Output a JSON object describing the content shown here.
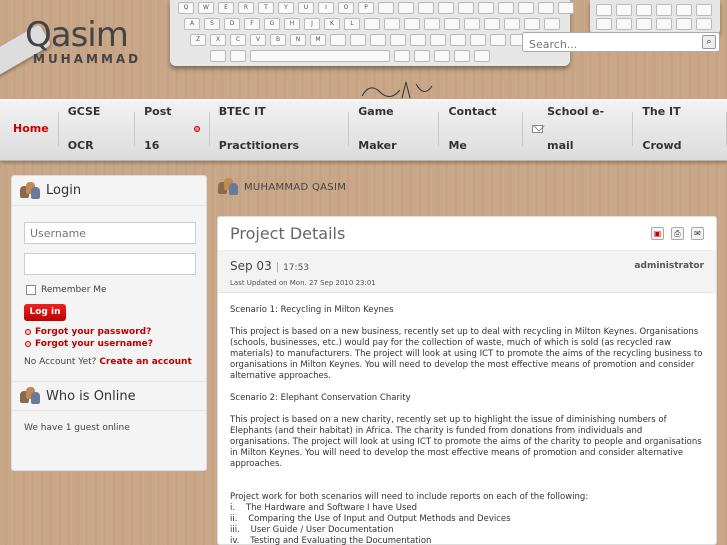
{
  "header": {
    "logo_main": "Qasim",
    "logo_sub": "MUHAMMAD",
    "search_placeholder": "Search..."
  },
  "nav": {
    "items": [
      {
        "label": "Home",
        "active": true
      },
      {
        "label": "GCSE OCR"
      },
      {
        "label": "Post 16"
      },
      {
        "label": "BTEC IT Practitioners"
      },
      {
        "label": "Game Maker"
      },
      {
        "label": "Contact Me"
      },
      {
        "label": "School e-mail"
      },
      {
        "label": "The IT Crowd"
      }
    ]
  },
  "login": {
    "title": "Login",
    "username_placeholder": "Username",
    "password_placeholder": "",
    "remember_label": "Remember Me",
    "login_button": "Log in",
    "forgot_password": "Forgot your password?",
    "forgot_username": "Forgot your username?",
    "no_account": "No Account Yet?",
    "create_account": "Create an account"
  },
  "who_online": {
    "title": "Who is Online",
    "text": "We have 1 guest online"
  },
  "breadcrumb": "MUHAMMAD QASIM",
  "article": {
    "title": "Project Details",
    "date": "Sep 03",
    "time": "17:53",
    "author": "administrator",
    "updated": "Last Updated on Mon. 27 Sep 2010 23:01",
    "scenario1_title": "Scenario 1: Recycling in Milton Keynes",
    "scenario1_text": "This project is based on a new business, recently set up to deal with recycling in Milton Keynes. Organisations (schools, businesses, etc.) would pay for the collection of waste, much of which is sold (as recycled raw materials) to manufacturers. The project will look at using ICT to promote the aims of the recycling business to organisations in Milton Keynes. You will need to develop the most effective means of promotion and consider alternative approaches.",
    "scenario2_title": "Scenario 2: Elephant Conservation Charity",
    "scenario2_text": "This project is based on a new charity, recently set up to highlight the issue of diminishing numbers of Elephants (and their habitat) in Africa. The charity is funded from donations from individuals and organisations. The project will look at using ICT to promote the aims of the charity to people and organisations in Milton Keynes. You will need to develop the most effective means of promotion and consider alternative approaches.",
    "reports_intro": "Project work for both scenarios will need to include reports on each of the following:",
    "reports": [
      "i.    The Hardware and Software I have Used",
      "ii.    Comparing the Use of Input and Output Methods and Devices",
      "iii.    User Guide / User Documentation",
      "iv.    Testing and Evaluating the Documentation"
    ]
  }
}
